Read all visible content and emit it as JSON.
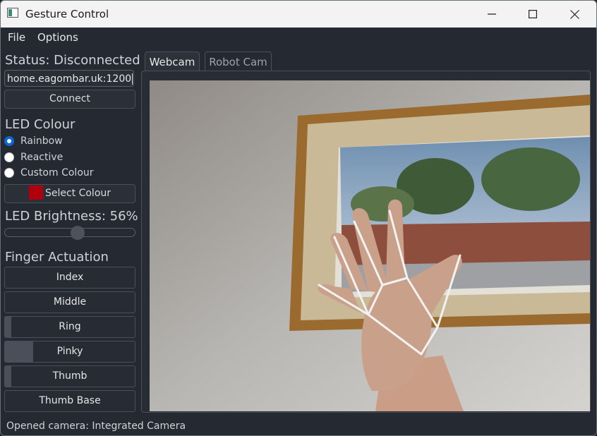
{
  "window": {
    "title": "Gesture Control"
  },
  "menu": {
    "items": [
      "File",
      "Options"
    ]
  },
  "connection": {
    "status": "Status: Disconnected",
    "address": "home.eagombar.uk:1200",
    "connect_label": "Connect"
  },
  "led": {
    "heading": "LED Colour",
    "modes": [
      {
        "label": "Rainbow",
        "selected": true
      },
      {
        "label": "Reactive",
        "selected": false
      },
      {
        "label": "Custom Colour",
        "selected": false
      }
    ],
    "select_colour_label": "Select Colour",
    "custom_colour": "#b0000d",
    "brightness_label": "LED Brightness: 56%",
    "brightness": 56
  },
  "fingers": {
    "heading": "Finger Actuation",
    "items": [
      {
        "label": "Index",
        "actuation": 0
      },
      {
        "label": "Middle",
        "actuation": 0
      },
      {
        "label": "Ring",
        "actuation": 0.05
      },
      {
        "label": "Pinky",
        "actuation": 0.22
      },
      {
        "label": "Thumb",
        "actuation": 0.05
      },
      {
        "label": "Thumb Base",
        "actuation": 0
      }
    ]
  },
  "tabs": [
    {
      "label": "Webcam",
      "active": true
    },
    {
      "label": "Robot Cam",
      "active": false
    }
  ],
  "statusbar": {
    "message": "Opened camera: Integrated Camera"
  },
  "colors": {
    "accent": "#0a67d3",
    "background": "#252932"
  }
}
